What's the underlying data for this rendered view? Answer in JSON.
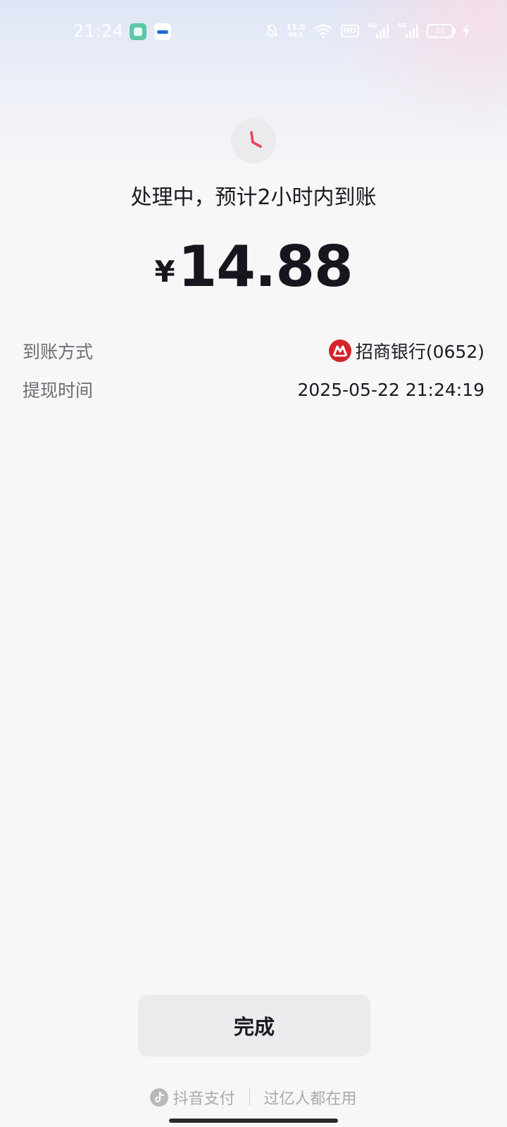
{
  "status_bar": {
    "time": "21:24",
    "net_speed_value": "11.0",
    "net_speed_unit": "KB/S",
    "hd_label": "HD",
    "signal1_tag": "4G",
    "signal2_tag": "4G",
    "battery": "21"
  },
  "main": {
    "status_text": "处理中，预计2小时内到账",
    "currency": "¥",
    "amount": "14.88",
    "rows": [
      {
        "label": "到账方式",
        "value": "招商银行(0652)"
      },
      {
        "label": "提现时间",
        "value": "2025-05-22 21:24:19"
      }
    ],
    "done_label": "完成"
  },
  "footer": {
    "brand": "抖音支付",
    "slogan": "过亿人都在用"
  },
  "colors": {
    "clock_hand": "#e8455c",
    "bank_red": "#d5222a",
    "background": "#f7f7f8"
  }
}
